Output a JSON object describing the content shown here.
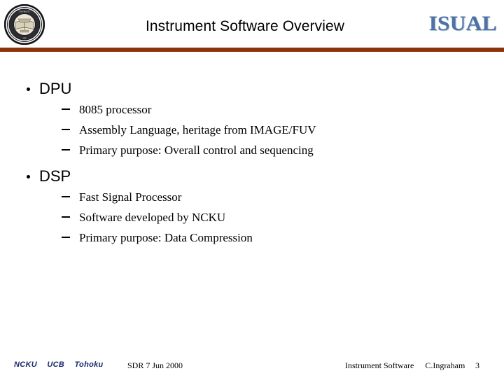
{
  "header": {
    "title": "Instrument Software Overview",
    "logo_text": "ISUAL",
    "seal_name": "university-seal",
    "rule_color": "#8b3309",
    "logo_color": "#4d72a3"
  },
  "body": {
    "sections": [
      {
        "label": "DPU",
        "items": [
          "8085 processor",
          "Assembly Language, heritage from IMAGE/FUV",
          "Primary purpose: Overall control and sequencing"
        ]
      },
      {
        "label": "DSP",
        "items": [
          "Fast Signal Processor",
          "Software developed by NCKU",
          "Primary purpose:  Data Compression"
        ]
      }
    ]
  },
  "footer": {
    "partners": [
      "NCKU",
      "UCB",
      "Tohoku"
    ],
    "partners_color": "#1b2a6b",
    "document": "SDR 7 Jun 2000",
    "topic": "Instrument Software",
    "author": "C.Ingraham",
    "page_number": "3"
  }
}
